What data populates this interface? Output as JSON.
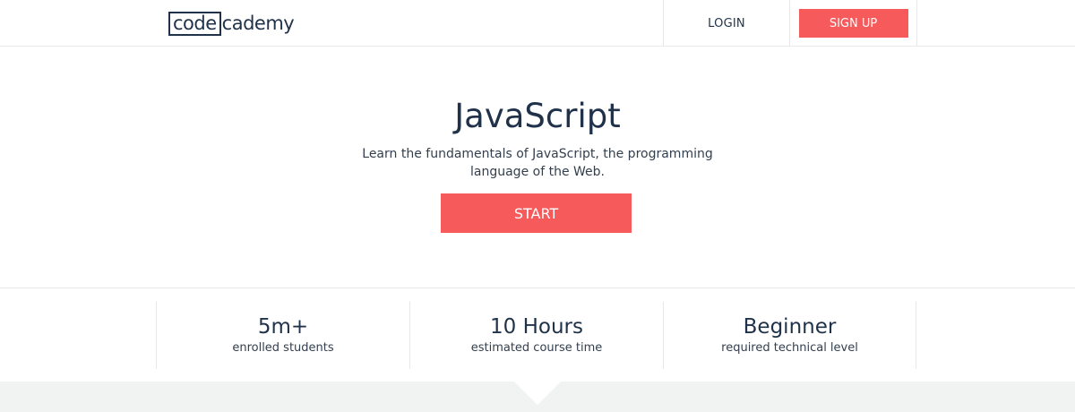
{
  "header": {
    "logo": {
      "boxed_text": "code",
      "rest_text": "cademy"
    },
    "login_label": "LOGIN",
    "signup_label": "SIGN UP"
  },
  "hero": {
    "title": "JavaScript",
    "subtitle": "Learn the fundamentals of JavaScript, the programming language of the Web.",
    "start_label": "START"
  },
  "stats": [
    {
      "value": "5m+",
      "label": "enrolled students"
    },
    {
      "value": "10 Hours",
      "label": "estimated course time"
    },
    {
      "value": "Beginner",
      "label": "required technical level"
    }
  ],
  "colors": {
    "accent": "#f65a5b",
    "text_dark": "#1f3249",
    "divider": "#e6e8ea",
    "footer_bg": "#f1f2f2"
  }
}
